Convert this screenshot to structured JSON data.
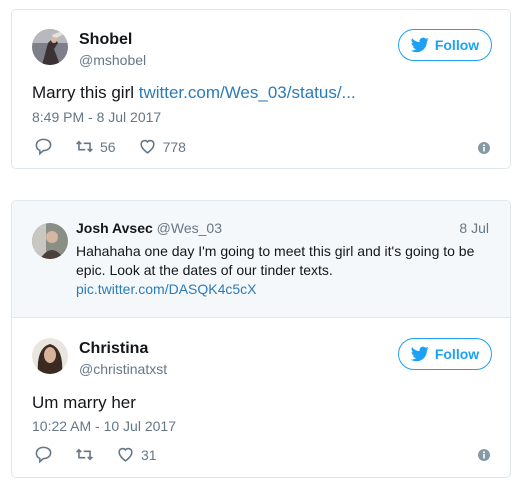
{
  "tweet1": {
    "author_name": "Shobel",
    "author_handle": "@mshobel",
    "follow_label": "Follow",
    "text": "Marry this girl ",
    "link": "twitter.com/Wes_03/status/...",
    "timestamp": "8:49 PM - 8 Jul 2017",
    "retweets": "56",
    "likes": "778"
  },
  "tweet2": {
    "quoted": {
      "author_name": "Josh Avsec",
      "author_handle": "@Wes_03",
      "date": "8 Jul",
      "text_line1": "Hahahaha one day I'm going to meet this girl and it's going to be",
      "text_line2": "epic. Look at the dates of our tinder texts.",
      "link": "pic.twitter.com/DASQK4c5cX"
    },
    "author_name": "Christina",
    "author_handle": "@christinatxst",
    "follow_label": "Follow",
    "text": "Um marry her",
    "timestamp": "10:22 AM - 10 Jul 2017",
    "likes": "31"
  },
  "colors": {
    "accent": "#1da1f2",
    "link": "#2b7bb9",
    "muted": "#657786",
    "border": "#e1e8ed",
    "quote_bg": "#f5f8fa"
  }
}
